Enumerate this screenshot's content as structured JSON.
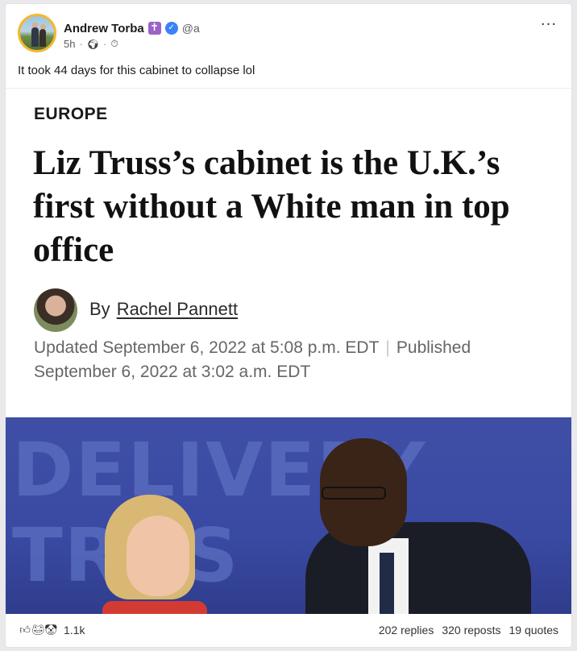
{
  "post": {
    "author_name": "Andrew Torba",
    "author_badge": "✝",
    "handle": "@a",
    "time": "5h",
    "text": "It took 44 days for this cabinet to collapse lol"
  },
  "article": {
    "kicker": "EUROPE",
    "headline": "Liz Truss’s cabinet is the U.K.’s first without a White man in top office",
    "by": "By",
    "author": "Rachel Pannett",
    "updated": "Updated September 6, 2022 at 5:08 p.m. EDT",
    "separator": "|",
    "published": "Published September 6, 2022 at 3:02 a.m. EDT",
    "photo_text_1": "DELIVERY",
    "photo_text_2": "TRUS"
  },
  "footer": {
    "reaction_icons": [
      "thumbs-up-icon",
      "face-icon",
      "clown-icon"
    ],
    "reaction_count": "1.1k",
    "replies": "202 replies",
    "reposts": "320 reposts",
    "quotes": "19 quotes"
  },
  "colors": {
    "avatar_ring": "#f2b92f",
    "badge_purple": "#9a63c7",
    "verified_blue": "#3b82f6",
    "photo_background": "#3f4fa6"
  }
}
